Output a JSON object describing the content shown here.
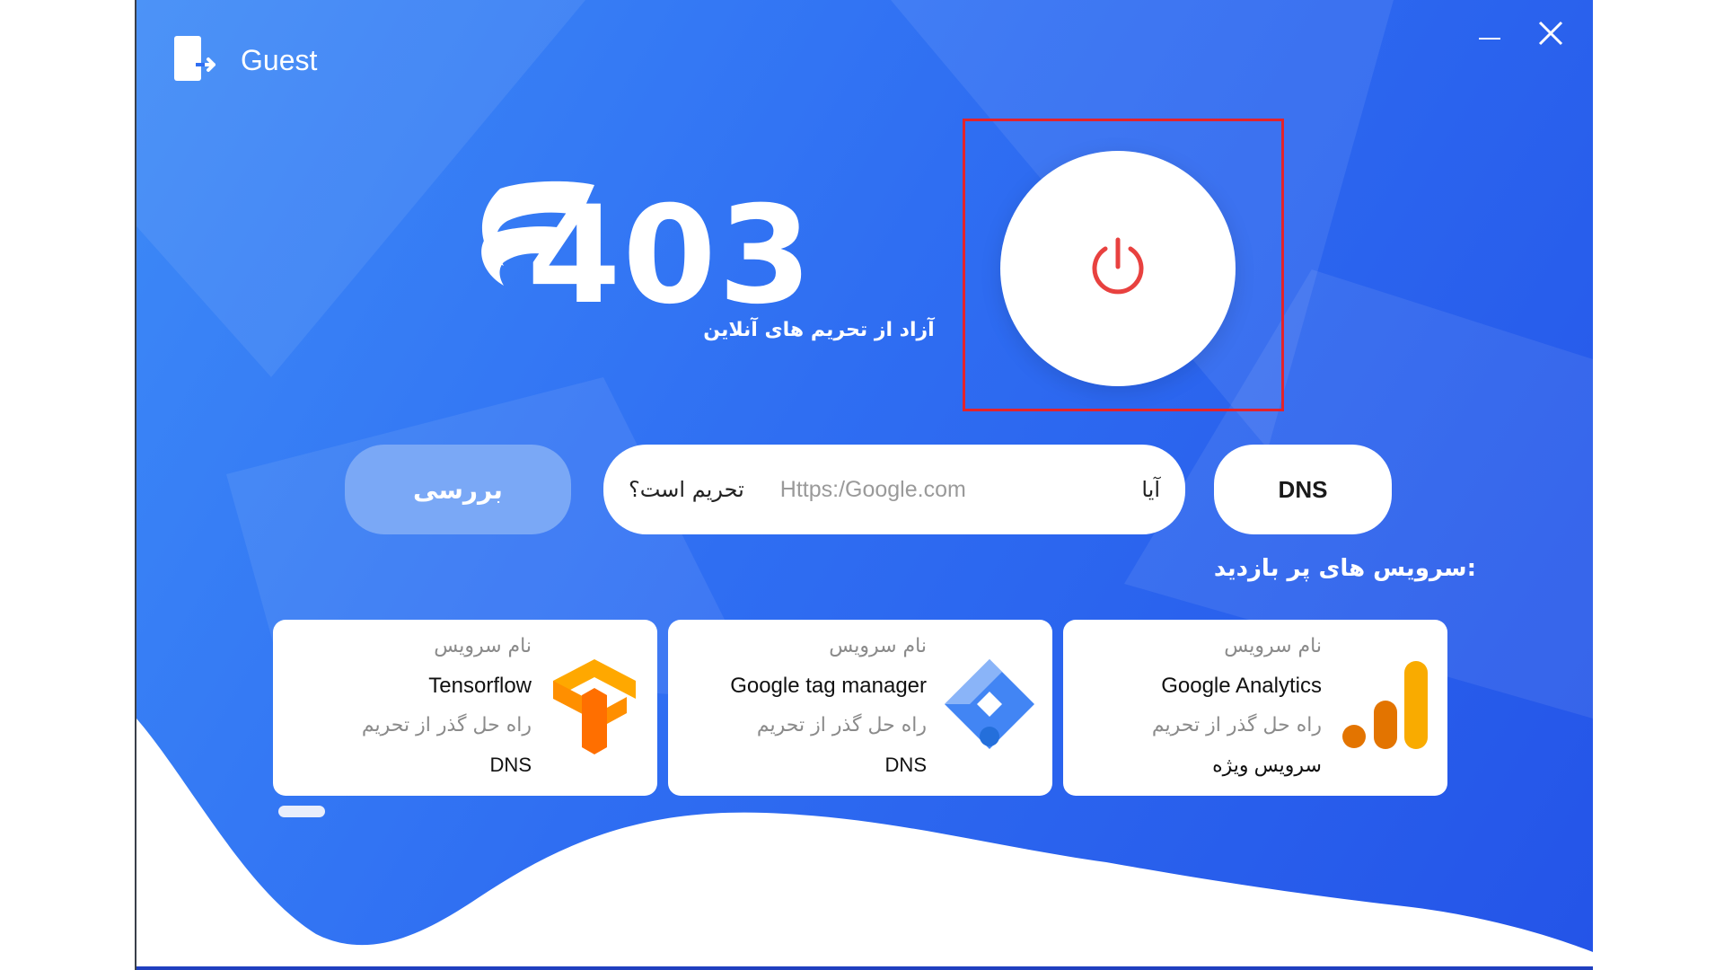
{
  "titlebar": {
    "user_name": "Guest",
    "logout_icon": "logout-icon",
    "minimize_icon": "minimize-icon",
    "close_icon": "close-icon"
  },
  "brand": {
    "logo_text": "403",
    "tagline": "آزاد از تحریم های آنلاین",
    "logo_color": "#ffffff"
  },
  "connect": {
    "icon": "power-icon",
    "icon_color": "#e8413f",
    "highlight_color": "#e3232b"
  },
  "checker": {
    "check_button_label": "بررسی",
    "prefix": "آیا",
    "url_placeholder": "Https:/Google.com",
    "suffix": "تحریم است؟",
    "dns_button_label": "DNS"
  },
  "popular": {
    "title": "سرویس های پر بازدید:",
    "cards": [
      {
        "label": "نام سرویس",
        "name": "Google Analytics",
        "solution": "راه حل گذر از تحریم",
        "type": "سرویس ویژه",
        "icon": "google-analytics-icon"
      },
      {
        "label": "نام سرویس",
        "name": "Google tag manager",
        "solution": "راه حل گذر از تحریم",
        "type": "DNS",
        "icon": "google-tag-manager-icon"
      },
      {
        "label": "نام سرویس",
        "name": "Tensorflow",
        "solution": "راه حل گذر از تحریم",
        "type": "DNS",
        "icon": "tensorflow-icon"
      }
    ]
  },
  "colors": {
    "background_start": "#3d8af7",
    "background_end": "#2454e8",
    "check_button": "#7aa8f6"
  }
}
